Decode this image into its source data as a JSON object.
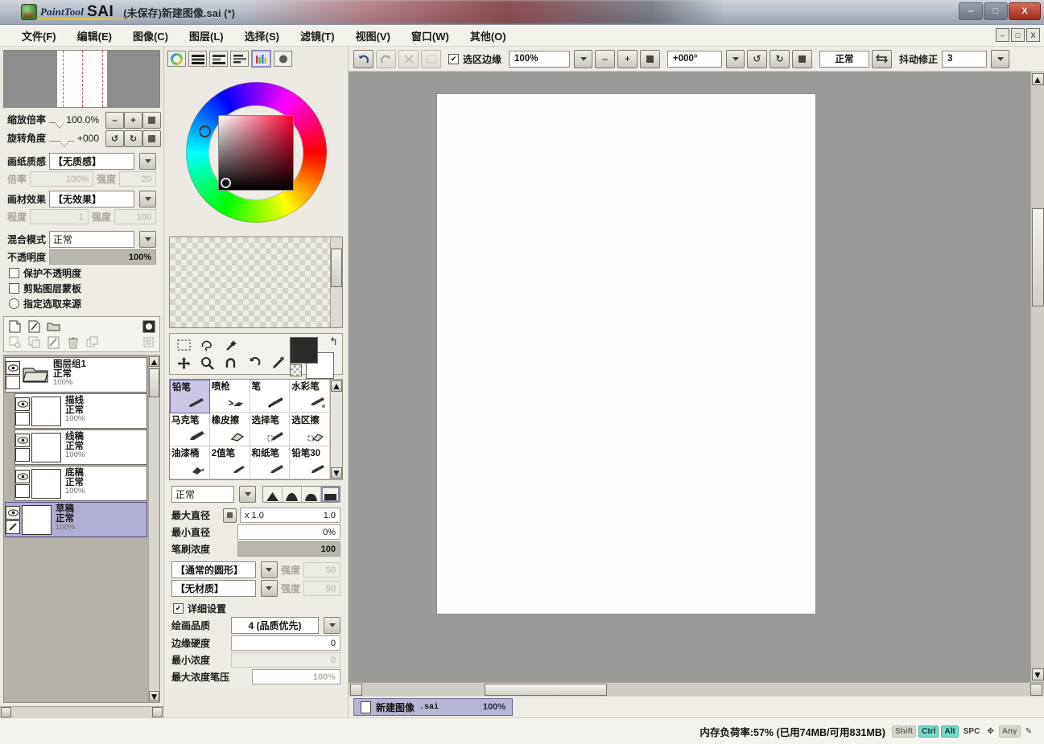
{
  "window": {
    "app_name_script": "PaintTool",
    "app_name_bold": "SAI",
    "document_title": "(未保存)新建图像.sai (*)",
    "minimize": "–",
    "maximize": "□",
    "close": "X"
  },
  "menubar": {
    "items": [
      {
        "label": "文件(F)",
        "name": "menu-file"
      },
      {
        "label": "编辑(E)",
        "name": "menu-edit"
      },
      {
        "label": "图像(C)",
        "name": "menu-image"
      },
      {
        "label": "图层(L)",
        "name": "menu-layer"
      },
      {
        "label": "选择(S)",
        "name": "menu-select"
      },
      {
        "label": "滤镜(T)",
        "name": "menu-filter"
      },
      {
        "label": "视图(V)",
        "name": "menu-view"
      },
      {
        "label": "窗口(W)",
        "name": "menu-window"
      },
      {
        "label": "其他(O)",
        "name": "menu-other"
      }
    ],
    "panel_buttons": [
      "–",
      "□",
      "X"
    ]
  },
  "navigator": {
    "zoom_label": "缩放倍率",
    "zoom_value": "100.0%",
    "rotate_label": "旋转角度",
    "rotate_value": "+000",
    "buttons": {
      "zoom_out": "–",
      "zoom_in": "+",
      "zoom_reset": "■",
      "rotate_left": "↺",
      "rotate_right": "↻",
      "rotate_reset": "■"
    }
  },
  "paper_settings": {
    "texture_label": "画纸质感",
    "texture_value": "【无质感】",
    "scale_label": "倍率",
    "scale_value": "100%",
    "strength_label": "强度",
    "strength_value": "20",
    "effect_label": "画材效果",
    "effect_value": "【无效果】",
    "degree_label": "程度",
    "degree_value": "1",
    "effect_strength_label": "强度",
    "effect_strength_value": "100"
  },
  "layer_props": {
    "blend_label": "混合模式",
    "blend_value": "正常",
    "opacity_label": "不透明度",
    "opacity_value": "100%",
    "opacity_percent": 100,
    "checkbox_protect": "保护不透明度",
    "checkbox_clipping": "剪贴图层蒙板",
    "radio_selection_source": "指定选取来源"
  },
  "layer_toolbar": {
    "row1": [
      "new-layer-icon",
      "new-linework-layer-icon",
      "new-folder-icon",
      "layer-mask-icon"
    ],
    "row2": [
      "merge-down-icon",
      "merge-group-icon",
      "clear-layer-icon",
      "delete-layer-icon",
      "copy-layer-icon",
      "paste-layer-icon"
    ]
  },
  "layers": {
    "items": [
      {
        "name": "图层组1",
        "mode": "正常",
        "opacity": "100%",
        "type": "folder",
        "selected": false,
        "indent": false
      },
      {
        "name": "描线",
        "mode": "正常",
        "opacity": "100%",
        "type": "raster",
        "selected": false,
        "indent": true
      },
      {
        "name": "线稿",
        "mode": "正常",
        "opacity": "100%",
        "type": "raster",
        "selected": false,
        "indent": true
      },
      {
        "name": "底稿",
        "mode": "正常",
        "opacity": "100%",
        "type": "raster",
        "selected": false,
        "indent": true
      },
      {
        "name": "草稿",
        "mode": "正常",
        "opacity": "100%",
        "type": "raster",
        "selected": true,
        "indent": false
      }
    ]
  },
  "color_panel": {
    "tabs": [
      {
        "name": "color-wheel-tab",
        "active": false
      },
      {
        "name": "rgb-sliders-tab",
        "active": false
      },
      {
        "name": "hsv-sliders-tab",
        "active": false
      },
      {
        "name": "gradient-tab",
        "active": false
      },
      {
        "name": "palette-tab",
        "active": true
      },
      {
        "name": "mixer-tab",
        "active": false
      }
    ],
    "foreground_color": "#2b2b2b",
    "background_color": "#ffffff",
    "hue_accent": "#ff0033"
  },
  "tools": {
    "row1": [
      "rect-select-icon",
      "lasso-select-icon",
      "magic-wand-icon"
    ],
    "row2": [
      "move-icon",
      "zoom-icon",
      "rotate-canvas-icon",
      "undo-stroke-icon",
      "eyedropper-icon"
    ]
  },
  "brush_presets": [
    {
      "label": "铅笔",
      "selected": true
    },
    {
      "label": "喷枪",
      "selected": false
    },
    {
      "label": "笔",
      "selected": false
    },
    {
      "label": "水彩笔",
      "selected": false
    },
    {
      "label": "马克笔",
      "selected": false
    },
    {
      "label": "橡皮擦",
      "selected": false
    },
    {
      "label": "选择笔",
      "selected": false
    },
    {
      "label": "选区擦",
      "selected": false
    },
    {
      "label": "油漆桶",
      "selected": false
    },
    {
      "label": "2值笔",
      "selected": false
    },
    {
      "label": "和纸笔",
      "selected": false
    },
    {
      "label": "铅笔30",
      "selected": false
    }
  ],
  "brush_settings": {
    "blend_mode": "正常",
    "edge_shape_selected_index": 3,
    "max_diameter_label": "最大直径",
    "max_diameter_unit": "x 1.0",
    "max_diameter_value": "1.0",
    "min_diameter_label": "最小直径",
    "min_diameter_value": "0%",
    "density_label": "笔刷浓度",
    "density_value": "100",
    "density_percent": 100,
    "shape_label": "【通常的圆形】",
    "shape_strength_label": "强度",
    "shape_strength_value": "50",
    "texture_label": "【无材质】",
    "texture_strength_label": "强度",
    "texture_strength_value": "50",
    "detail_checkbox": "详细设置",
    "quality_label": "绘画品质",
    "quality_value": "4 (品质优先)",
    "edge_hardness_label": "边缘硬度",
    "edge_hardness_value": "0",
    "min_density_label": "最小浓度",
    "min_density_value": "0",
    "max_density_pressure_label": "最大浓度笔压",
    "max_density_pressure_value": "100%"
  },
  "canvas_toolbar": {
    "undo": "↺",
    "redo": "↻",
    "selection_edge_label": "选区边缘",
    "zoom_value": "100%",
    "zoom_out": "–",
    "zoom_in": "+",
    "zoom_reset": "■",
    "rotate_value": "+000°",
    "rotate_left": "↺",
    "rotate_right": "↻",
    "rotate_reset": "■",
    "view_mode": "正常",
    "flip_icon": "flip-horizontal-icon",
    "stabilizer_label": "抖动修正",
    "stabilizer_value": "3"
  },
  "document_tab": {
    "filename_main": "新建图像",
    "filename_ext": ".sai",
    "zoom": "100%"
  },
  "statusbar": {
    "memory_text": "内存负荷率:57% (已用74MB/可用831MB)",
    "keys": [
      {
        "label": "Shift",
        "active": false
      },
      {
        "label": "Ctrl",
        "active": true
      },
      {
        "label": "Alt",
        "active": true
      },
      {
        "label": "SPC",
        "active": false
      },
      {
        "label": "✥",
        "active": false
      },
      {
        "label": "Any",
        "active": false
      },
      {
        "label": "✎",
        "active": false
      }
    ]
  }
}
